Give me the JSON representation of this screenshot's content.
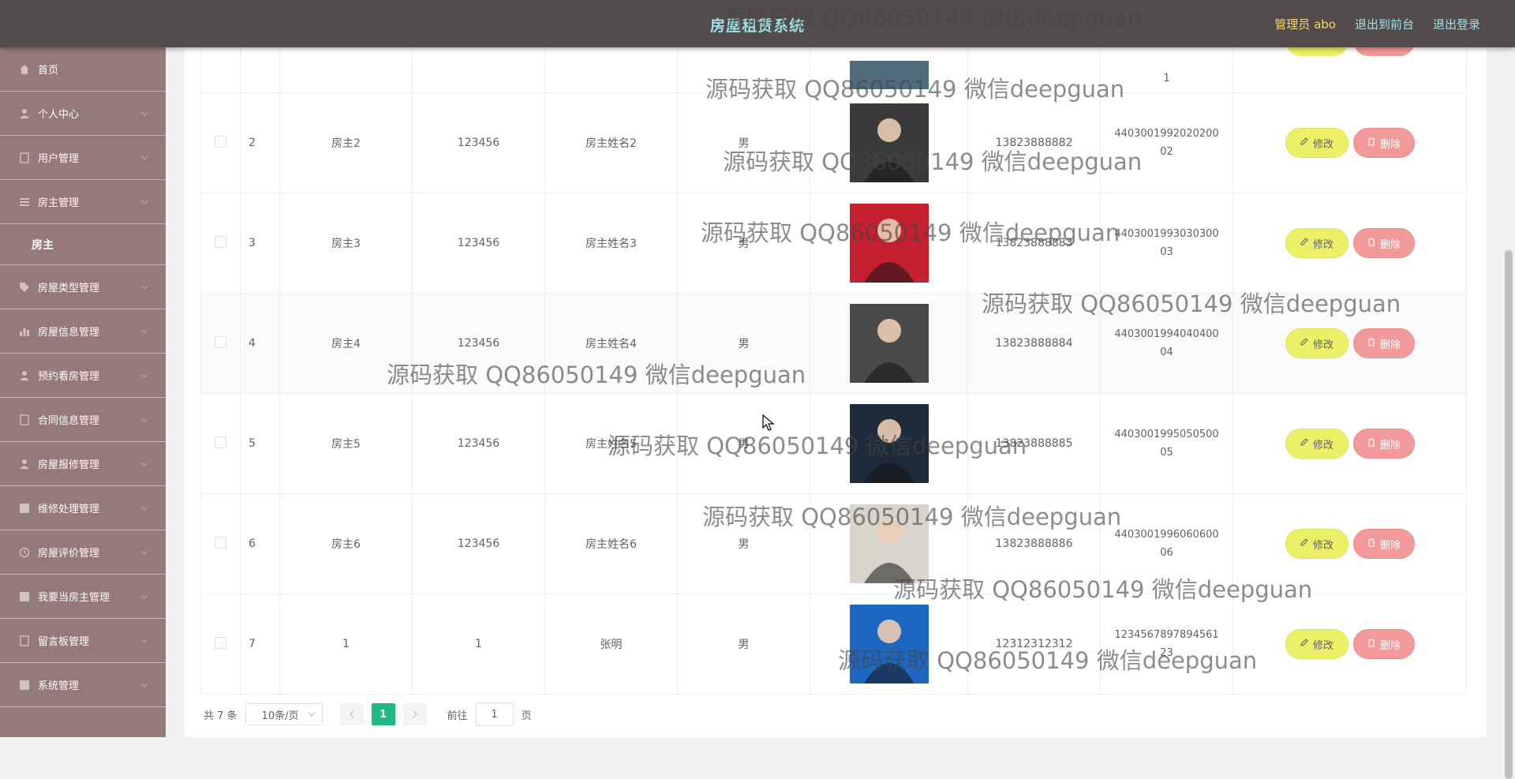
{
  "header": {
    "title": "房屋租赁系统",
    "admin": "管理员 abo",
    "to_front": "退出到前台",
    "logout": "退出登录"
  },
  "sidebar": {
    "items": [
      {
        "label": "首页",
        "icon": "home-icon"
      },
      {
        "label": "个人中心",
        "icon": "user-icon"
      },
      {
        "label": "用户管理",
        "icon": "doc-icon"
      },
      {
        "label": "房主管理",
        "icon": "menu-icon"
      },
      {
        "label": "房主",
        "sub": true
      },
      {
        "label": "房屋类型管理",
        "icon": "tag-icon"
      },
      {
        "label": "房屋信息管理",
        "icon": "chart-icon"
      },
      {
        "label": "预约看房管理",
        "icon": "user-icon"
      },
      {
        "label": "合同信息管理",
        "icon": "doc-icon"
      },
      {
        "label": "房屋报修管理",
        "icon": "user-icon"
      },
      {
        "label": "维修处理管理",
        "icon": "grid-icon"
      },
      {
        "label": "房屋评价管理",
        "icon": "clock-icon"
      },
      {
        "label": "我要当房主管理",
        "icon": "grid-icon"
      },
      {
        "label": "留言板管理",
        "icon": "doc-icon"
      },
      {
        "label": "系统管理",
        "icon": "grid-icon"
      }
    ]
  },
  "table": {
    "partial_top_row": {
      "idcard_tail": "1"
    },
    "rows": [
      {
        "index": "2",
        "account": "房主2",
        "password": "123456",
        "name": "房主姓名2",
        "gender": "男",
        "phone": "13823888882",
        "idcard": "440300199202020002",
        "photo_color": "#3b3b3b"
      },
      {
        "index": "3",
        "account": "房主3",
        "password": "123456",
        "name": "房主姓名3",
        "gender": "男",
        "phone": "13823888883",
        "idcard": "440300199303030003",
        "photo_color": "#c4202f"
      },
      {
        "index": "4",
        "account": "房主4",
        "password": "123456",
        "name": "房主姓名4",
        "gender": "男",
        "phone": "13823888884",
        "idcard": "440300199404040004",
        "photo_color": "#4a4a4a"
      },
      {
        "index": "5",
        "account": "房主5",
        "password": "123456",
        "name": "房主姓名5",
        "gender": "男",
        "phone": "13823888885",
        "idcard": "440300199505050005",
        "photo_color": "#1f2a3a"
      },
      {
        "index": "6",
        "account": "房主6",
        "password": "123456",
        "name": "房主姓名6",
        "gender": "男",
        "phone": "13823888886",
        "idcard": "440300199606060006",
        "photo_color": "#d9d4cc"
      },
      {
        "index": "7",
        "account": "1",
        "password": "1",
        "name": "张明",
        "gender": "男",
        "phone": "12312312312",
        "idcard": "123456789789456123",
        "photo_color": "#1d67c0"
      }
    ],
    "edit_label": "修改",
    "delete_label": "删除"
  },
  "pagination": {
    "total": "共 7 条",
    "page_size": "10条/页",
    "current": "1",
    "goto_prefix": "前往",
    "goto_value": "1",
    "goto_suffix": "页"
  },
  "watermark": "源码获取 QQ86050149 微信deepguan",
  "colors": {
    "topbar": "#534c4c",
    "sidebar": "#967979",
    "title": "#9fe0e6",
    "edit": "#ecf067",
    "delete": "#f29a9a",
    "active_page": "#1fba83"
  }
}
